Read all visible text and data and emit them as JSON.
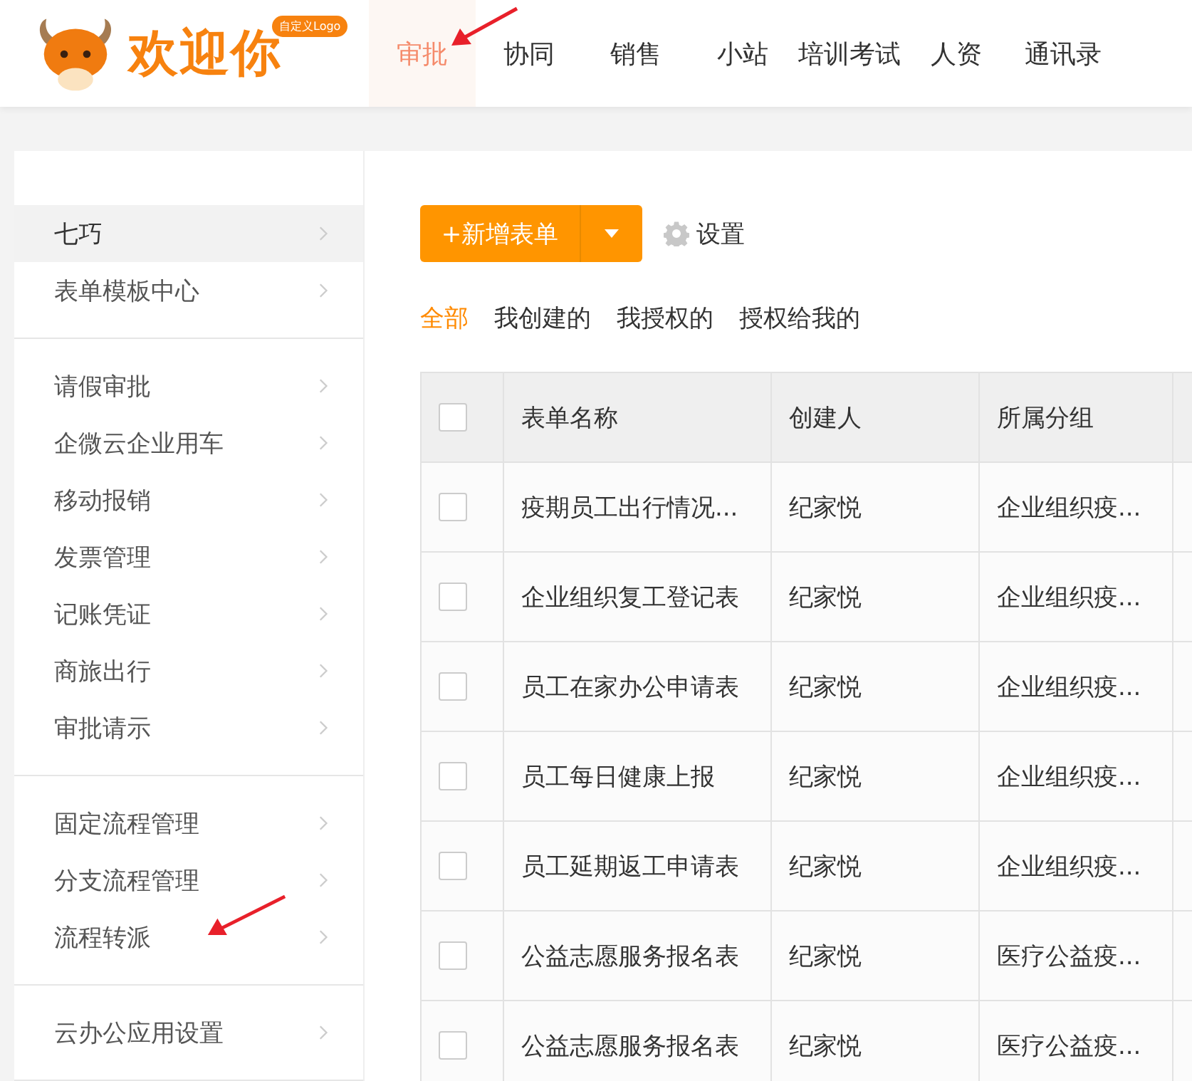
{
  "header": {
    "logo_text": "欢迎你",
    "logo_badge": "自定义Logo",
    "nav": [
      {
        "label": "审批",
        "selected": true
      },
      {
        "label": "协同",
        "selected": false
      },
      {
        "label": "销售",
        "selected": false
      },
      {
        "label": "小站",
        "selected": false
      },
      {
        "label": "培训考试",
        "selected": false
      },
      {
        "label": "人资",
        "selected": false
      },
      {
        "label": "通讯录",
        "selected": false
      }
    ]
  },
  "sidebar": {
    "groups": [
      [
        {
          "label": "七巧",
          "selected": true
        },
        {
          "label": "表单模板中心",
          "selected": false
        }
      ],
      [
        {
          "label": "请假审批",
          "selected": false
        },
        {
          "label": "企微云企业用车",
          "selected": false
        },
        {
          "label": "移动报销",
          "selected": false
        },
        {
          "label": "发票管理",
          "selected": false
        },
        {
          "label": "记账凭证",
          "selected": false
        },
        {
          "label": "商旅出行",
          "selected": false
        },
        {
          "label": "审批请示",
          "selected": false
        }
      ],
      [
        {
          "label": "固定流程管理",
          "selected": false
        },
        {
          "label": "分支流程管理",
          "selected": false
        },
        {
          "label": "流程转派",
          "selected": false
        }
      ],
      [
        {
          "label": "云办公应用设置",
          "selected": false
        }
      ]
    ]
  },
  "toolbar": {
    "new_button": "+新增表单",
    "settings": "设置"
  },
  "filters": [
    {
      "label": "全部",
      "selected": true
    },
    {
      "label": "我创建的",
      "selected": false
    },
    {
      "label": "我授权的",
      "selected": false
    },
    {
      "label": "授权给我的",
      "selected": false
    }
  ],
  "table": {
    "all_checked": false,
    "columns": [
      "表单名称",
      "创建人",
      "所属分组"
    ],
    "rows": [
      {
        "checked": false,
        "cells": [
          "疫期员工出行情况...",
          "纪家悦",
          "企业组织疫..."
        ]
      },
      {
        "checked": false,
        "cells": [
          "企业组织复工登记表",
          "纪家悦",
          "企业组织疫..."
        ]
      },
      {
        "checked": false,
        "cells": [
          "员工在家办公申请表",
          "纪家悦",
          "企业组织疫..."
        ]
      },
      {
        "checked": false,
        "cells": [
          "员工每日健康上报",
          "纪家悦",
          "企业组织疫..."
        ]
      },
      {
        "checked": false,
        "cells": [
          "员工延期返工申请表",
          "纪家悦",
          "企业组织疫..."
        ]
      },
      {
        "checked": false,
        "cells": [
          "公益志愿服务报名表",
          "纪家悦",
          "医疗公益疫..."
        ]
      },
      {
        "checked": false,
        "cells": [
          "公益志愿服务报名表",
          "纪家悦",
          "医疗公益疫..."
        ]
      }
    ]
  }
}
